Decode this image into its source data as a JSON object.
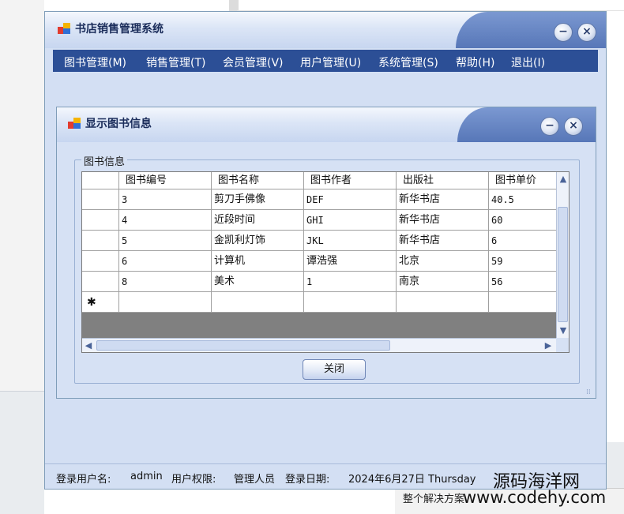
{
  "app": {
    "title": "书店销售管理系统",
    "minimize_glyph": "−",
    "close_glyph": "×"
  },
  "menu": {
    "items": [
      {
        "label": "图书管理(M)"
      },
      {
        "label": "销售管理(T)"
      },
      {
        "label": "会员管理(V)"
      },
      {
        "label": "用户管理(U)"
      },
      {
        "label": "系统管理(S)"
      },
      {
        "label": "帮助(H)"
      },
      {
        "label": "退出(I)"
      }
    ]
  },
  "child": {
    "title": "显示图书信息",
    "group_label": "图书信息",
    "columns": [
      "图书编号",
      "图书名称",
      "图书作者",
      "出版社",
      "图书单价"
    ],
    "rows": [
      [
        "3",
        "剪刀手佛像",
        "DEF",
        "新华书店",
        "40.5"
      ],
      [
        "4",
        "近段时间",
        "GHI",
        "新华书店",
        "60"
      ],
      [
        "5",
        "金凯利灯饰",
        "JKL",
        "新华书店",
        "6"
      ],
      [
        "6",
        "计算机",
        "谭浩强",
        "北京",
        "59"
      ],
      [
        "8",
        "美术",
        "1",
        "南京",
        "56"
      ]
    ],
    "new_row_marker": "✱",
    "close_button": "关闭"
  },
  "status": {
    "user_label": "登录用户名:",
    "user_value": "admin",
    "role_label": "用户权限:",
    "role_value": "管理人员",
    "date_label": "登录日期:",
    "date_value": "2024年6月27日 Thursday"
  },
  "background": {
    "solution_text": "整个解决方案"
  },
  "watermark": {
    "line1": "源码海洋网",
    "line2": "www.codehy.com"
  },
  "colors": {
    "menu_bar": "#2c4f96",
    "window_bg": "#d3dff3",
    "title_accent": "#5777b8"
  }
}
